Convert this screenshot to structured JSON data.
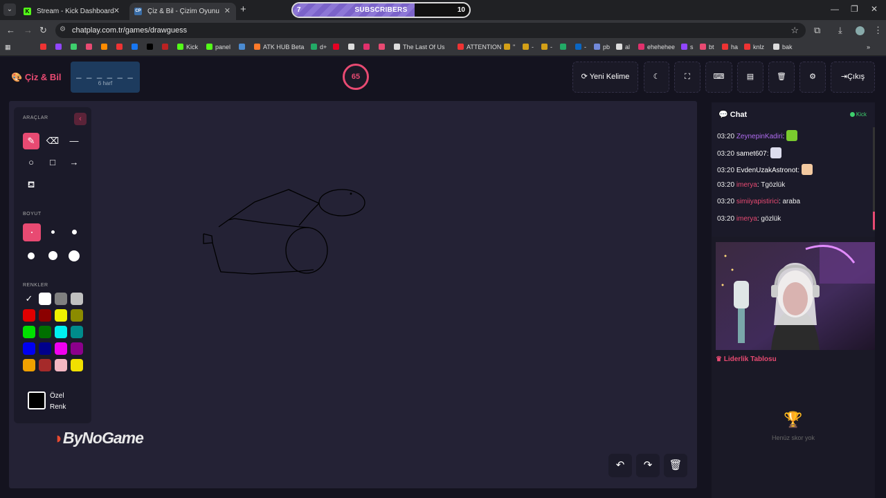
{
  "browser": {
    "tabs": [
      {
        "label": "Stream - Kick Dashboard",
        "fav": "K",
        "color": "#53fc18"
      },
      {
        "label": "Çiz & Bil - Çizim Oyunu",
        "fav": "CP",
        "color": "#3b6ea8"
      }
    ],
    "subscribers": {
      "label": "SUBSCRIBERS",
      "min": "7",
      "max": "10",
      "progress": 0.69
    },
    "url": "chatplay.com.tr/games/drawguess",
    "bookmarks": [
      {
        "label": "",
        "color": "#e33"
      },
      {
        "label": "",
        "color": "#9146ff"
      },
      {
        "label": "",
        "color": "#3ecf6d"
      },
      {
        "label": "",
        "color": "#e84a72"
      },
      {
        "label": "",
        "color": "#ff8c00"
      },
      {
        "label": "",
        "color": "#e33"
      },
      {
        "label": "",
        "color": "#1877f2"
      },
      {
        "label": "",
        "color": "#000"
      },
      {
        "label": "",
        "color": "#b22"
      },
      {
        "label": "Kick",
        "color": "#53fc18"
      },
      {
        "label": "panel",
        "color": "#53fc18"
      },
      {
        "label": "",
        "color": "#4b8bd1"
      },
      {
        "label": "ATK HUB Beta",
        "color": "#ff7a2a"
      },
      {
        "label": "d+",
        "color": "#2a6"
      },
      {
        "label": "",
        "color": "#e60023"
      },
      {
        "label": "",
        "color": "#ddd"
      },
      {
        "label": "",
        "color": "#e1306c"
      },
      {
        "label": "",
        "color": "#e84a72"
      },
      {
        "label": "The Last Of Us",
        "color": "#ddd"
      },
      {
        "label": "ATTENTION",
        "color": "#e33"
      },
      {
        "label": "\"",
        "color": "#d4a017"
      },
      {
        "label": "-",
        "color": "#d4a017"
      },
      {
        "label": "-",
        "color": "#d4a017"
      },
      {
        "label": "",
        "color": "#2a6"
      },
      {
        "label": "-",
        "color": "#0a66c2"
      },
      {
        "label": "pb",
        "color": "#7289da"
      },
      {
        "label": "al",
        "color": "#ddd"
      },
      {
        "label": "ehehehee",
        "color": "#e1306c"
      },
      {
        "label": "s",
        "color": "#9146ff"
      },
      {
        "label": "bt",
        "color": "#e84a72"
      },
      {
        "label": "ha",
        "color": "#e33"
      },
      {
        "label": "knlz",
        "color": "#e33"
      },
      {
        "label": "bak",
        "color": "#ddd"
      }
    ]
  },
  "header": {
    "logo": "Çiz & Bil",
    "word_blanks": "_ _ _ _ _ _",
    "word_hint": "6 harf",
    "timer": "65",
    "buttons": {
      "new_word": "Yeni Kelime",
      "exit": "Çıkış"
    }
  },
  "tools": {
    "section_tools": "ARAÇLAR",
    "section_size": "BOYUT",
    "section_colors": "RENKLER",
    "custom_color_line1": "Özel",
    "custom_color_line2": "Renk",
    "colors": [
      "#000000",
      "#ffffff",
      "#808080",
      "#c0c0c0",
      "#e00000",
      "#8b0000",
      "#f0f000",
      "#8b8b00",
      "#00e000",
      "#007000",
      "#00f0f0",
      "#008b8b",
      "#0000f0",
      "#00008b",
      "#f000f0",
      "#8b008b",
      "#f0a000",
      "#a52a2a",
      "#f4b6c2",
      "#f0e000"
    ]
  },
  "brand_watermark": "ByNoGame",
  "chat": {
    "title": "Chat",
    "source": "Kick",
    "messages": [
      {
        "time": "03:20",
        "user": "ZeynepinKadiri",
        "user_color": "#b06cf0",
        "text": ""
      },
      {
        "time": "03:20",
        "user": "samet607",
        "user_color": "#ffffff",
        "text": ""
      },
      {
        "time": "03:20",
        "user": "EvdenUzakAstronot",
        "user_color": "#ffffff",
        "text": ""
      },
      {
        "time": "03:20",
        "user": "imerya",
        "user_color": "#e84a72",
        "text": "Tgözlük"
      },
      {
        "time": "03:20",
        "user": "simiiyapistirici",
        "user_color": "#e84a72",
        "text": "araba"
      },
      {
        "time": "03:20",
        "user": "imerya",
        "user_color": "#e84a72",
        "text": "gözlük"
      }
    ]
  },
  "leaderboard": {
    "title": "Liderlik Tablosu",
    "empty": "Henüz skor yok"
  }
}
